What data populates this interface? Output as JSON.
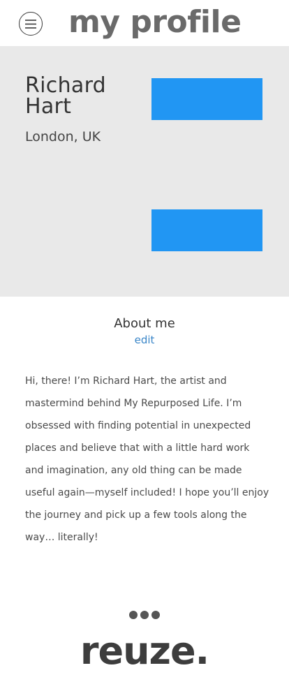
{
  "header": {
    "menu_icon": "hamburger-menu-icon",
    "title": "my profile"
  },
  "profile": {
    "name": "Richard Hart",
    "location": "London, UK",
    "button_color": "#2196f3",
    "panel_color": "#e9e9e9"
  },
  "about": {
    "heading": "About me",
    "edit_label": "edit",
    "body": "Hi, there! I’m Richard Hart, the artist and mastermind behind My Repurposed Life. I’m obsessed with finding potential in unexpected places and believe that with a little hard work and imagination, any old thing can be made useful again—myself included! I hope you’ll enjoy the journey and pick up a few tools along the way… literally!"
  },
  "footer": {
    "dots_icon": "more-dots-icon",
    "logo": "reuze."
  }
}
